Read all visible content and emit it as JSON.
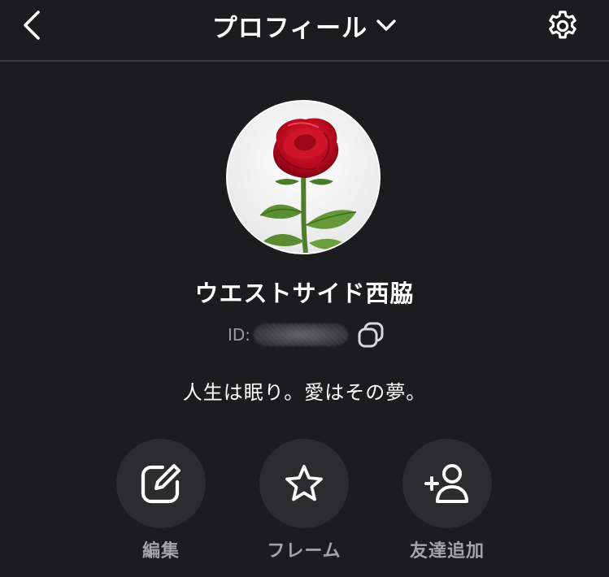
{
  "header": {
    "title": "プロフィール",
    "back_icon": "chevron-left-icon",
    "title_dropdown_icon": "chevron-down-icon",
    "settings_icon": "gear-icon"
  },
  "profile": {
    "avatar_alt": "rose-image",
    "name": "ウエストサイド西脇",
    "id_label": "ID:",
    "bio": "人生は眠り。愛はその夢。"
  },
  "actions": [
    {
      "label": "編集",
      "icon": "edit-icon"
    },
    {
      "label": "フレーム",
      "icon": "star-icon"
    },
    {
      "label": "友達追加",
      "icon": "add-friend-icon"
    }
  ],
  "colors": {
    "background": "#1c1c1e",
    "text_primary": "#ffffff",
    "text_secondary": "#a3a3a8",
    "button_bg": "#2c2c2e",
    "divider": "#3a3a3c"
  }
}
